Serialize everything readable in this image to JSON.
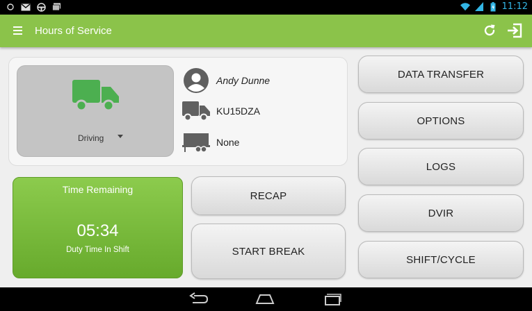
{
  "status_bar": {
    "time": "11:12",
    "left_icons": [
      "android-debug-icon",
      "gmail-icon",
      "steering-wheel-icon",
      "image-icon"
    ],
    "right_icons": [
      "wifi-icon",
      "signal-icon",
      "battery-icon"
    ]
  },
  "app_bar": {
    "title": "Hours of Service",
    "background_color": "#8bc34a"
  },
  "driver": {
    "status_label": "Driving",
    "name": "Andy Dunne",
    "vehicle": "KU15DZA",
    "trailer": "None"
  },
  "time_remaining": {
    "title": "Time Remaining",
    "value": "05:34",
    "subtitle": "Duty Time In Shift"
  },
  "buttons": {
    "recap": "RECAP",
    "start_break": "START BREAK",
    "data_transfer": "DATA TRANSFER",
    "options": "OPTIONS",
    "logs": "LOGS",
    "dvir": "DVIR",
    "shift_cycle": "SHIFT/CYCLE"
  },
  "colors": {
    "accent_green": "#8bc34a",
    "truck_green": "#4caf50",
    "status_blue": "#33b5e5"
  }
}
